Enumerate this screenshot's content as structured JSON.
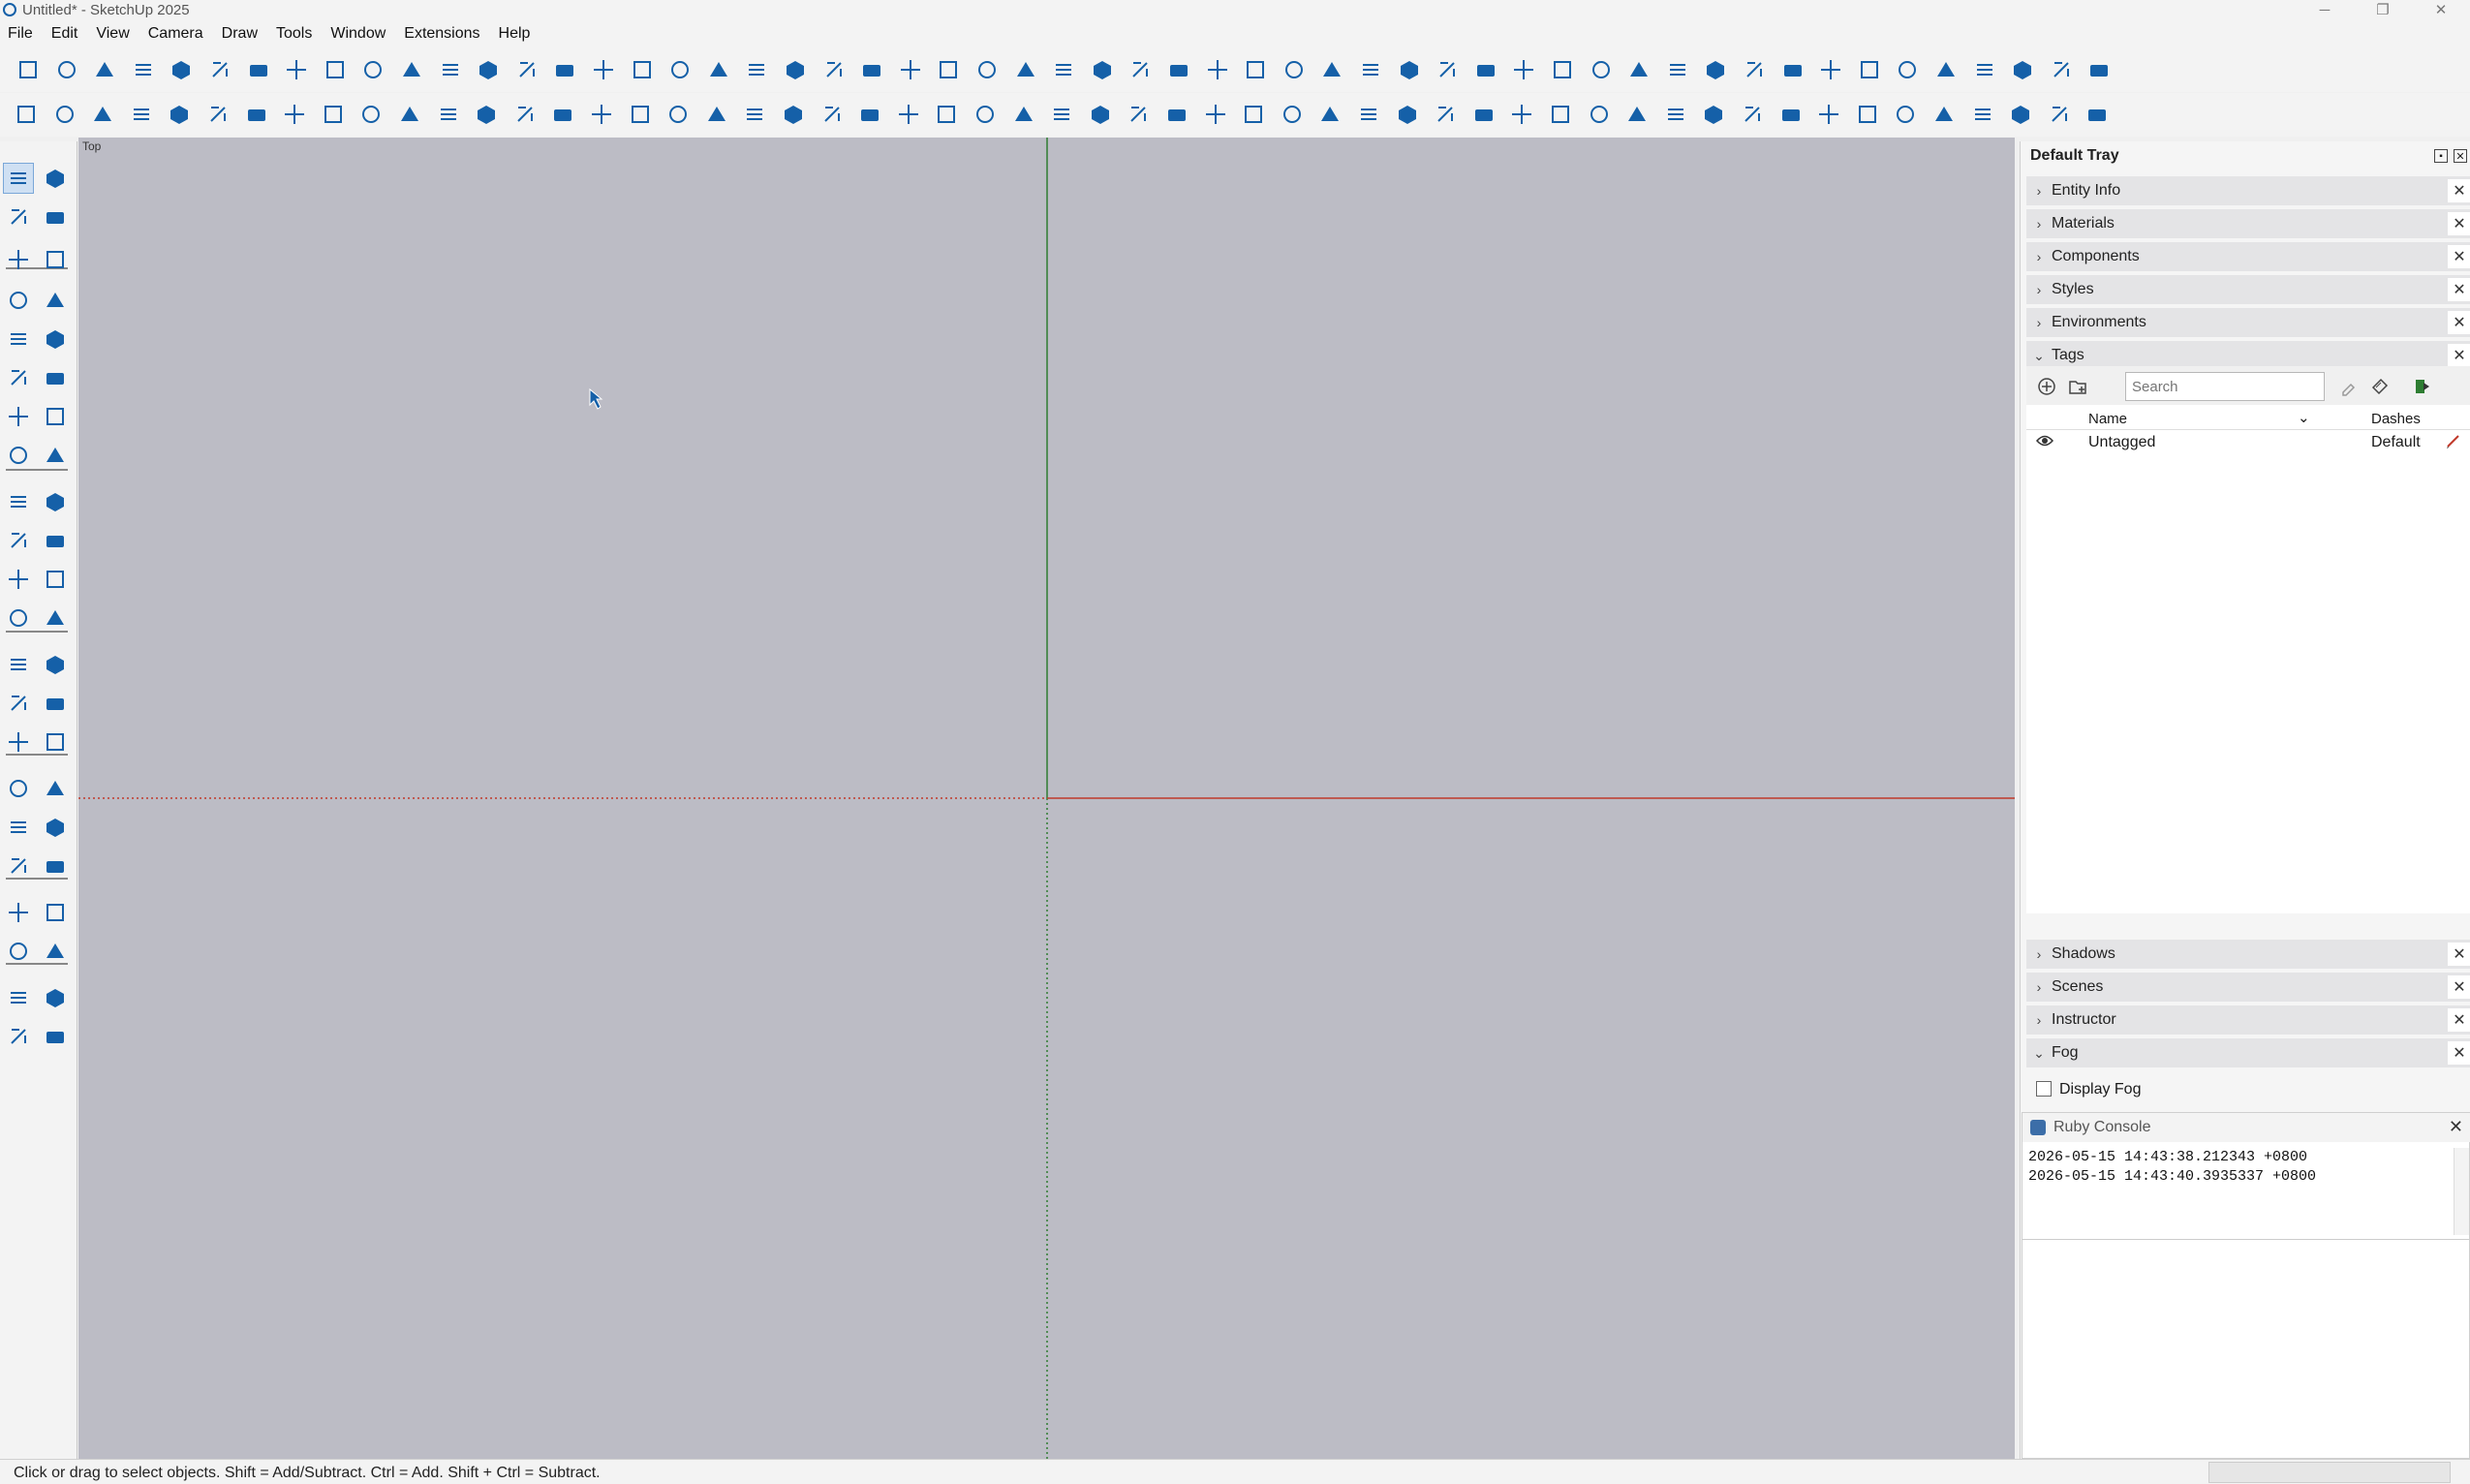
{
  "window": {
    "title": "Untitled* - SketchUp 2025",
    "minimize": "─",
    "maximize": "❐",
    "close": "✕"
  },
  "menu": [
    "File",
    "Edit",
    "View",
    "Camera",
    "Draw",
    "Tools",
    "Window",
    "Extensions",
    "Help"
  ],
  "accent": "#1560a8",
  "viewport": {
    "view_label": "Top",
    "background": "#bcbcc5",
    "red_axis": "#c0392b",
    "green_axis": "#2e7d32"
  },
  "tray": {
    "title": "Default Tray",
    "panels_top": [
      {
        "label": "Entity Info",
        "expanded": false
      },
      {
        "label": "Materials",
        "expanded": false
      },
      {
        "label": "Components",
        "expanded": false
      },
      {
        "label": "Styles",
        "expanded": false
      },
      {
        "label": "Environments",
        "expanded": false
      },
      {
        "label": "Tags",
        "expanded": true
      }
    ],
    "tags": {
      "search_placeholder": "Search",
      "columns": {
        "name": "Name",
        "dashes": "Dashes"
      },
      "rows": [
        {
          "name": "Untagged",
          "dashes": "Default",
          "visible": true
        }
      ]
    },
    "panels_bottom": [
      {
        "label": "Shadows",
        "expanded": false
      },
      {
        "label": "Scenes",
        "expanded": false
      },
      {
        "label": "Instructor",
        "expanded": false
      },
      {
        "label": "Fog",
        "expanded": true
      }
    ],
    "fog": {
      "label": "Display Fog",
      "checked": false
    }
  },
  "ruby_console": {
    "title": "Ruby Console",
    "lines": [
      "2026-05-15 14:43:38.212343 +0800",
      "2026-05-15 14:43:40.3935337 +0800"
    ]
  },
  "status": {
    "text": "Click or drag to select objects. Shift = Add/Subtract. Ctrl = Add. Shift + Ctrl = Subtract."
  },
  "toolbar_icons_row1": [
    "new-file-icon",
    "open-file-icon",
    "save-icon",
    "cut-icon",
    "copy-icon",
    "paste-icon",
    "erase-icon",
    "undo-icon",
    "redo-icon",
    "print-icon",
    "model-info-icon",
    "iso-view-icon",
    "top-view-icon",
    "front-view-icon",
    "right-view-icon",
    "back-view-icon",
    "left-view-icon",
    "bottom-view-icon",
    "xray-icon",
    "back-edges-icon",
    "wireframe-icon",
    "hidden-line-icon",
    "shaded-icon",
    "shaded-textures-icon",
    "monochrome-icon",
    "zoom-icon",
    "angle-icon",
    "dimension-icon",
    "pencil-line-icon",
    "flip-icon",
    "align-icon",
    "lock-icon",
    "terrain-icon",
    "tent-icon",
    "roof-icon",
    "grid-icon",
    "stairs-icon",
    "wall-icon",
    "window-tool-icon",
    "auto-icon",
    "extension-1-icon",
    "extension-2-icon",
    "extension-3-icon",
    "house-icon",
    "text-tool-icon",
    "tree-icon",
    "tree-2-icon",
    "axis-icon",
    "tower-icon",
    "cube-icon",
    "fence-icon",
    "clip-icon",
    "scale-up-icon",
    "hide-icon",
    "check-icon"
  ],
  "toolbar_icons_row2": [
    "menu-icon",
    "sun-icon",
    "globe-icon",
    "section-icon",
    "warehouse-icon",
    "sandbox-icon",
    "layer-icon",
    "plane-icon",
    "grid-2-icon",
    "plane-2-icon",
    "trash-icon",
    "percent-icon",
    "wand-icon",
    "wand-2-icon",
    "pipe-icon",
    "select-grid-icon",
    "label-icon",
    "path-icon",
    "spiral-icon",
    "curve-icon",
    "loop-icon",
    "ground-icon",
    "link-icon",
    "rail-icon",
    "axes-icon",
    "resize-icon",
    "add-icon",
    "cad-icon",
    "measure-icon",
    "tree-node-icon",
    "map-icon",
    "slope-icon",
    "move-icon",
    "table-icon",
    "sliders-icon",
    "dropbox-icon",
    "cloud-db-icon",
    "yen-icon",
    "kwh-icon",
    "irr-icon",
    "clipboard-icon",
    "gear-icon",
    "users-icon",
    "en-icon",
    "help-icon",
    "cloud-upload-icon",
    "refresh-icon",
    "database-icon",
    "loss-icon",
    "bi-icon",
    "play-icon",
    "explode-icon",
    "split-icon",
    "image-icon",
    "obj-icon"
  ],
  "left_tools": [
    [
      "select-icon",
      "lasso-icon"
    ],
    [
      "paint-bucket-icon",
      "eraser-icon"
    ],
    [
      "tag-tool-icon",
      "eraser-2-icon"
    ],
    [
      "line-icon",
      "freehand-icon"
    ],
    [
      "rectangle-icon",
      "rotated-rectangle-icon"
    ],
    [
      "circle-icon",
      "polygon-icon"
    ],
    [
      "arc-icon",
      "arc-2-icon"
    ],
    [
      "pie-icon",
      "arc-3-icon"
    ],
    [
      "move-tool-icon",
      "push-pull-icon"
    ],
    [
      "rotate-icon",
      "follow-me-icon"
    ],
    [
      "scale-icon",
      "offset-icon"
    ],
    [
      "solid-icon",
      "mirror-icon"
    ],
    [
      "tape-measure-icon",
      "dimension-tool-icon"
    ],
    [
      "protractor-icon",
      "text-label-icon"
    ],
    [
      "axes-tool-icon",
      "3d-text-icon"
    ],
    [
      "section-plane-icon",
      "pan-icon"
    ],
    [
      "zoom-tool-icon",
      "zoom-window-icon"
    ],
    [
      "zoom-extents-icon",
      "previous-view-icon"
    ],
    [
      "position-camera-icon",
      "walk-icon"
    ],
    [
      "look-around-icon",
      "field-of-view-icon"
    ],
    [
      "plugin-a-icon",
      "plugin-b-icon"
    ],
    [
      "plugin-c-icon",
      "plugin-d-icon"
    ]
  ]
}
